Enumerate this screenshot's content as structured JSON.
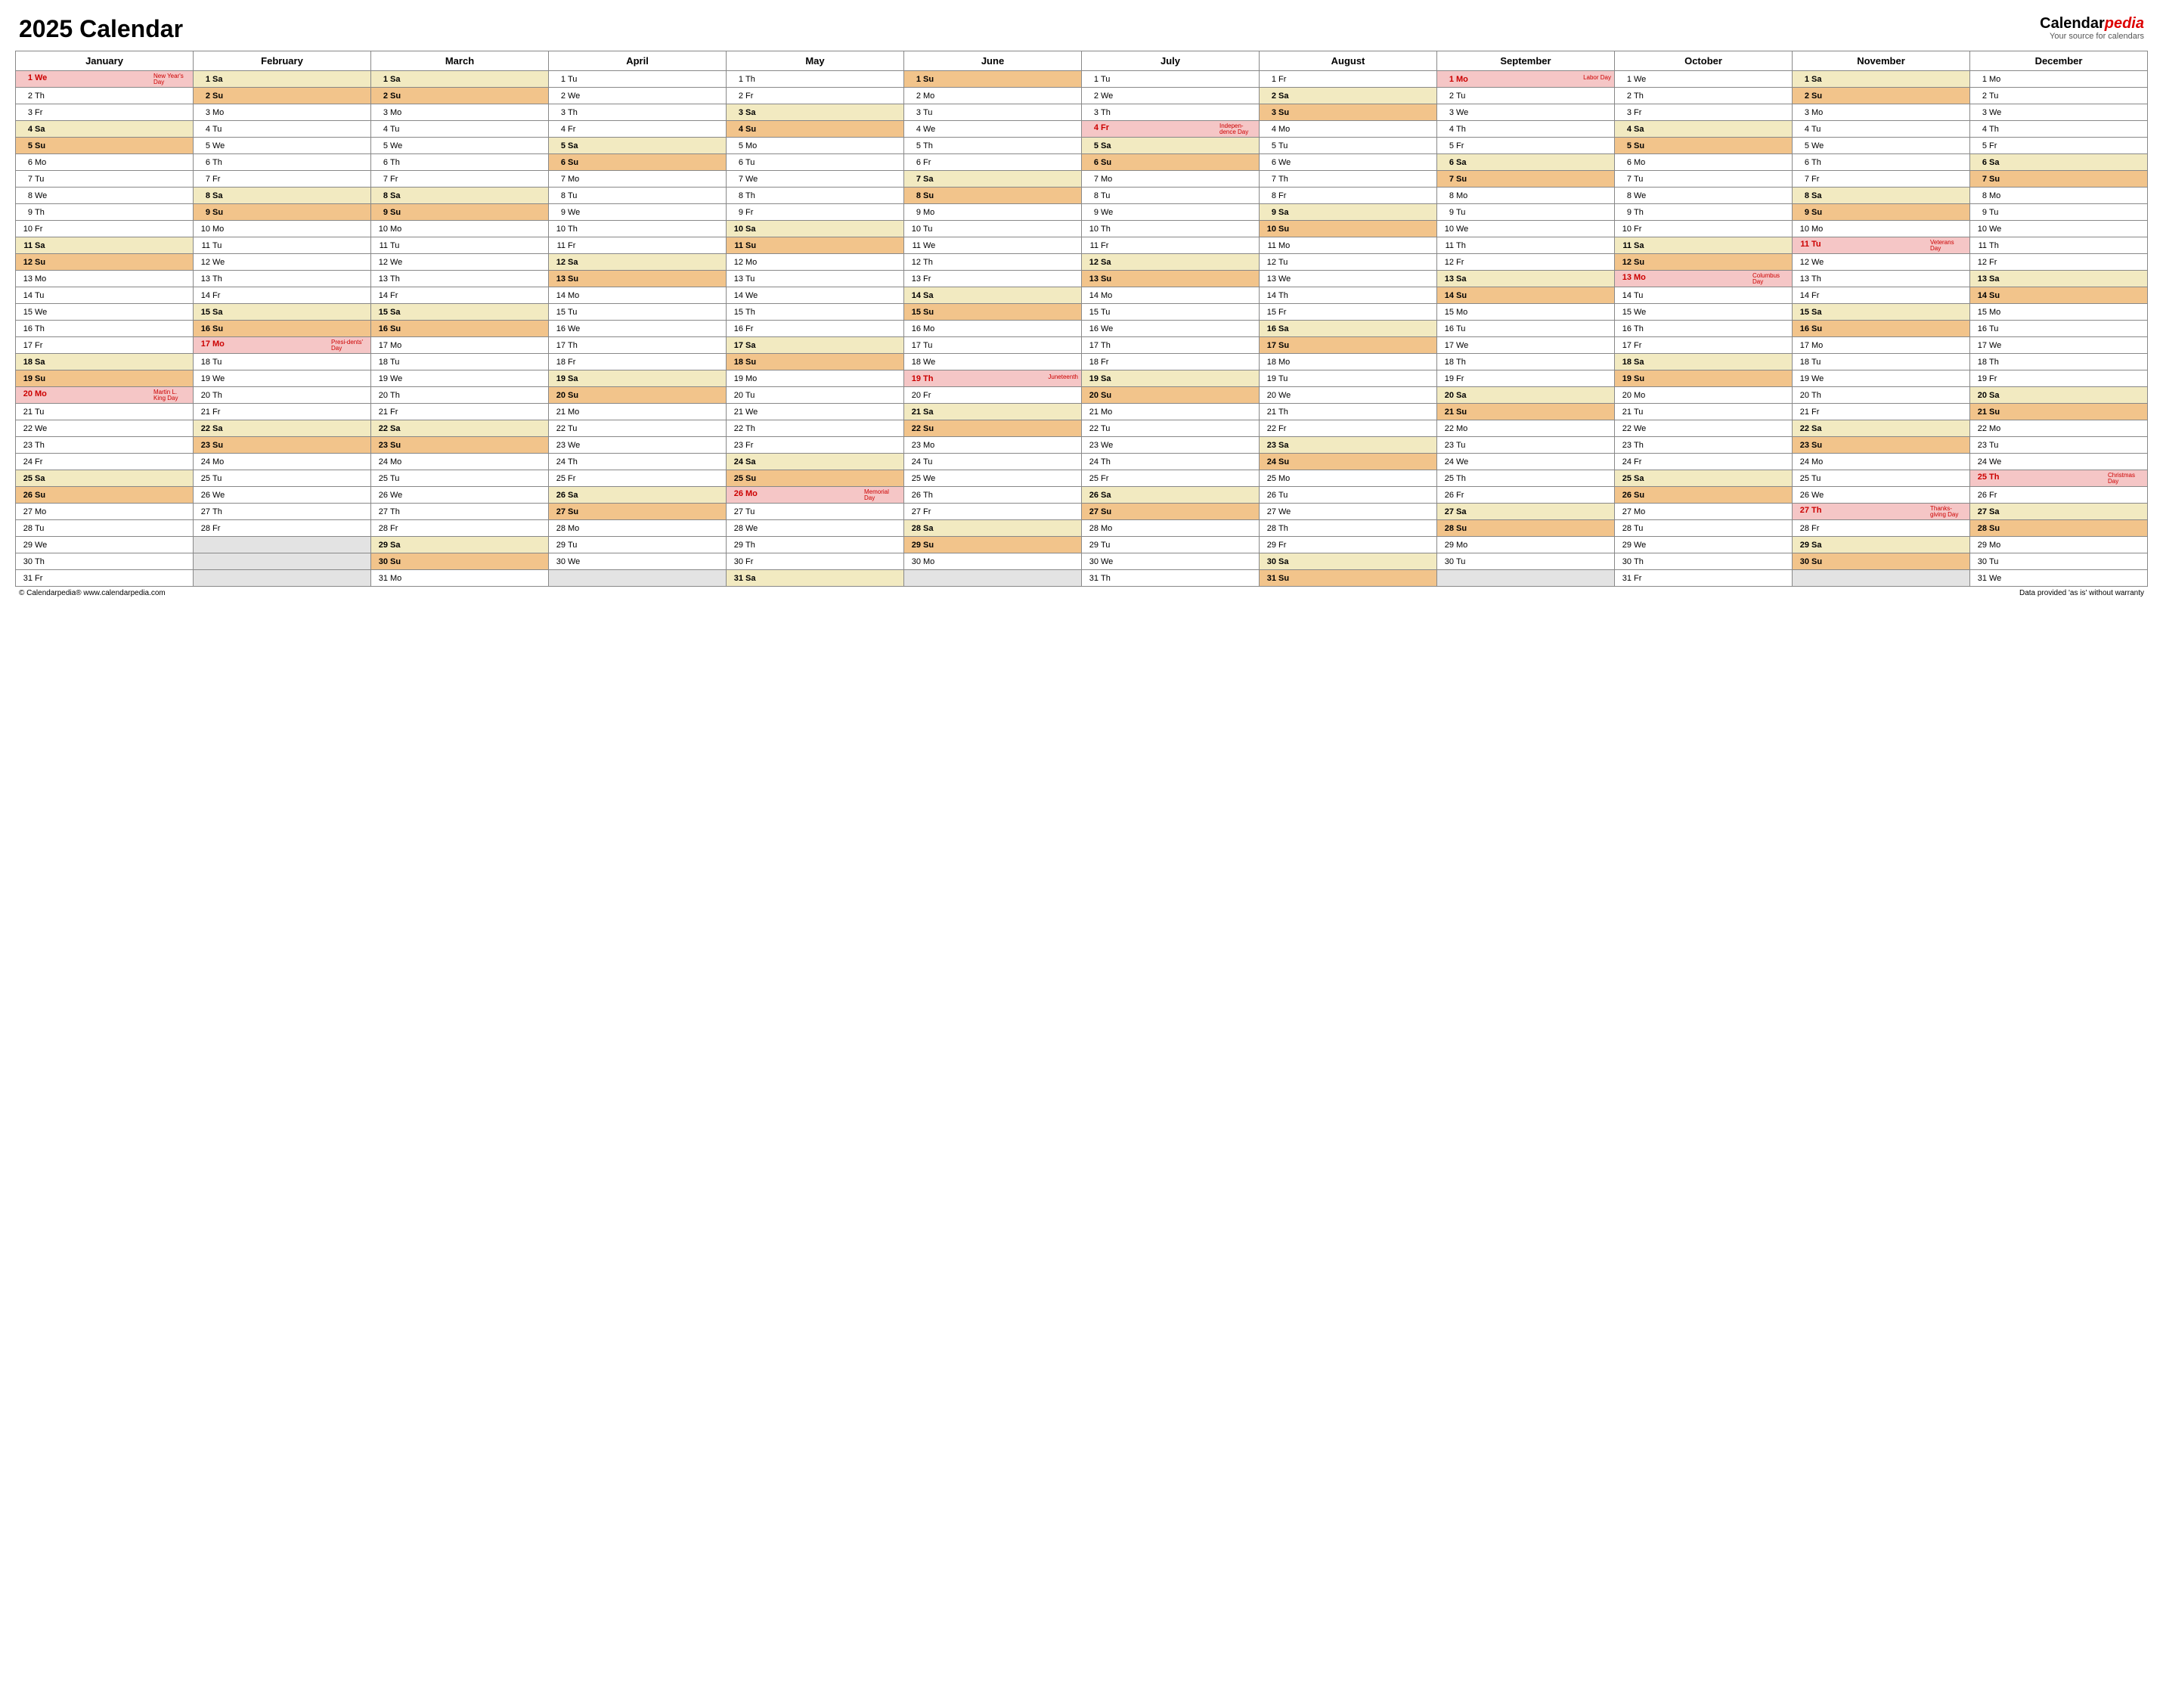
{
  "title": "2025 Calendar",
  "brand_main": "Calendar",
  "brand_em": "pedia",
  "brand_sub": "Your source for calendars",
  "footer_left": "© Calendarpedia®   www.calendarpedia.com",
  "footer_right": "Data provided 'as is' without warranty",
  "months": [
    "January",
    "February",
    "March",
    "April",
    "May",
    "June",
    "July",
    "August",
    "September",
    "October",
    "November",
    "December"
  ],
  "dow": [
    "Su",
    "Mo",
    "Tu",
    "We",
    "Th",
    "Fr",
    "Sa"
  ],
  "days_in_month": [
    31,
    28,
    31,
    30,
    31,
    30,
    31,
    31,
    30,
    31,
    30,
    31
  ],
  "first_dow": [
    3,
    6,
    6,
    2,
    4,
    0,
    2,
    5,
    1,
    3,
    6,
    1
  ],
  "holidays": {
    "0-1": {
      "name": "New Year's Day"
    },
    "0-20": {
      "name": "Martin L. King Day"
    },
    "1-17": {
      "name": "Presi-dents' Day"
    },
    "4-26": {
      "name": "Memorial Day"
    },
    "5-19": {
      "name": "Juneteenth"
    },
    "6-4": {
      "name": "Indepen-dence Day"
    },
    "8-1": {
      "name": "Labor Day"
    },
    "9-13": {
      "name": "Columbus Day"
    },
    "10-11": {
      "name": "Veterans Day"
    },
    "10-27": {
      "name": "Thanks-giving Day"
    },
    "11-25": {
      "name": "Christmas Day"
    }
  }
}
